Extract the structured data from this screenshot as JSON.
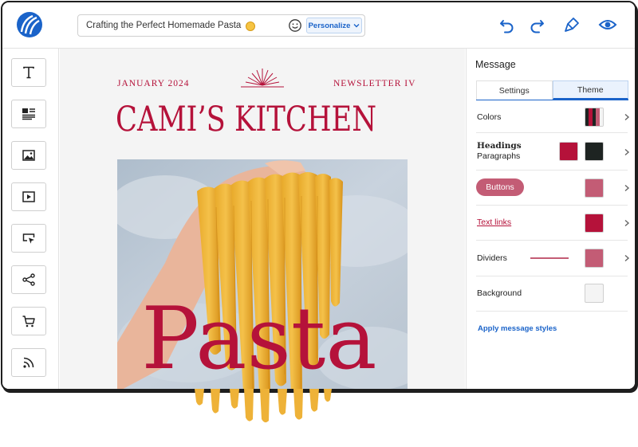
{
  "header": {
    "subject": "Crafting the Perfect Homemade Pasta",
    "personalize_label": "Personalize",
    "icons": [
      "logo-icon",
      "emoji-icon",
      "undo-icon",
      "redo-icon",
      "brush-icon",
      "preview-eye-icon"
    ]
  },
  "sidebar": {
    "items": [
      {
        "name": "text-block",
        "icon": "text-icon"
      },
      {
        "name": "text-image-block",
        "icon": "article-icon"
      },
      {
        "name": "image-block",
        "icon": "image-icon"
      },
      {
        "name": "video-block",
        "icon": "video-icon"
      },
      {
        "name": "button-block",
        "icon": "button-click-icon"
      },
      {
        "name": "social-block",
        "icon": "share-icon"
      },
      {
        "name": "product-block",
        "icon": "cart-icon"
      },
      {
        "name": "rss-block",
        "icon": "rss-icon"
      }
    ]
  },
  "email": {
    "date": "JANUARY 2024",
    "issue": "NEWSLETTER IV",
    "brand": "CAMI’S KITCHEN",
    "hero_word": "Pasta"
  },
  "panel": {
    "title": "Message",
    "tabs": [
      {
        "label": "Settings",
        "active": false
      },
      {
        "label": "Theme",
        "active": true
      }
    ],
    "colors_label": "Colors",
    "headings_label": "Headings",
    "paragraphs_label": "Paragraphs",
    "buttons_label": "Buttons",
    "text_links_label": "Text links",
    "dividers_label": "Dividers",
    "background_label": "Background",
    "apply_label": "Apply message styles"
  },
  "colors": {
    "accent_blue": "#1a63c9",
    "brand_red": "#b5123a",
    "dark": "#1e2422",
    "button_pink": "#c35c75",
    "background": "#f4f4f4"
  }
}
